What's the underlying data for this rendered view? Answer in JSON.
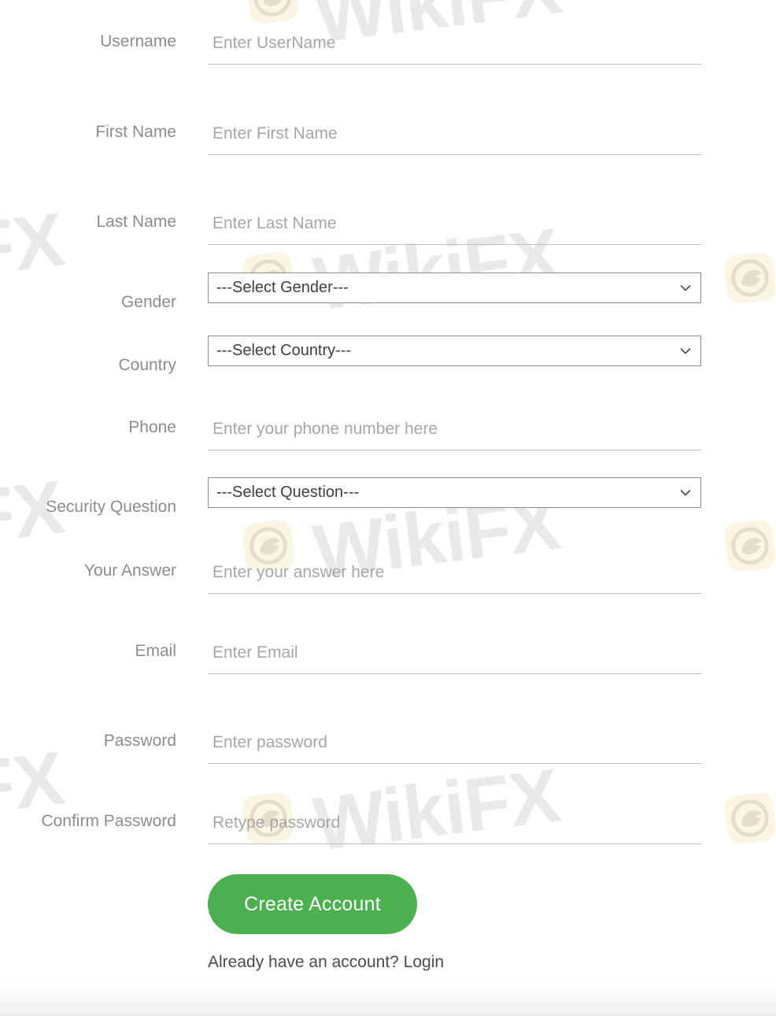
{
  "form": {
    "fields": [
      {
        "label": "Username",
        "type": "text",
        "placeholder": "Enter UserName",
        "value": ""
      },
      {
        "label": "First Name",
        "type": "text",
        "placeholder": "Enter First Name",
        "value": ""
      },
      {
        "label": "Last Name",
        "type": "text",
        "placeholder": "Enter Last Name",
        "value": ""
      },
      {
        "label": "Gender",
        "type": "select",
        "selected": "---Select Gender---",
        "value": ""
      },
      {
        "label": "Country",
        "type": "select",
        "selected": "---Select Country---",
        "value": ""
      },
      {
        "label": "Phone",
        "type": "text",
        "placeholder": "Enter your phone number here",
        "value": ""
      },
      {
        "label": "Security Question",
        "type": "select",
        "selected": "---Select Question---",
        "value": ""
      },
      {
        "label": "Your Answer",
        "type": "text",
        "placeholder": "Enter your answer here",
        "value": ""
      },
      {
        "label": "Email",
        "type": "text",
        "placeholder": "Enter Email",
        "value": ""
      },
      {
        "label": "Password",
        "type": "text",
        "placeholder": "Enter password",
        "value": ""
      },
      {
        "label": "Confirm Password",
        "type": "text",
        "placeholder": "Retype password",
        "value": ""
      }
    ],
    "submit_label": "Create Account",
    "login_prompt": "Already have an account? Login",
    "accent_color": "#4caf50",
    "label_color": "#8c8c8c",
    "placeholder_color": "#a6a6a6"
  },
  "watermark": {
    "text": "WikiFX",
    "logo_icon": "wikifx-eagle-logo-icon",
    "text_color": "#ebe9e7",
    "badge_color": "#fbf6e4"
  },
  "icons": {
    "chevron_down": "chevron-down-icon"
  }
}
